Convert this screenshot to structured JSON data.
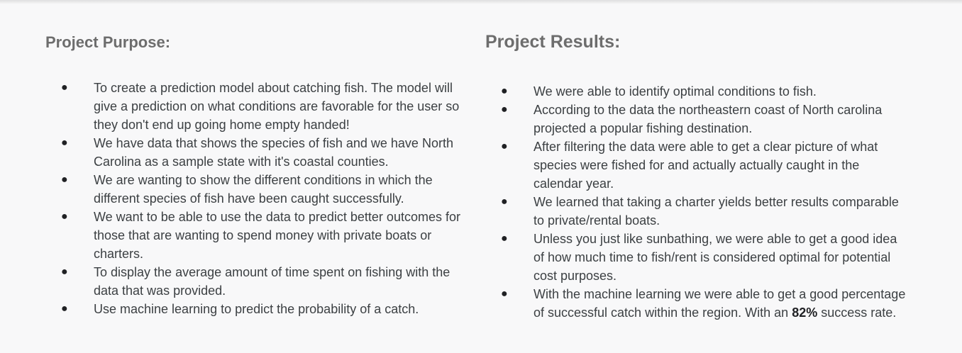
{
  "purpose": {
    "heading": "Project Purpose:",
    "items": [
      "To create a prediction model about catching fish. The model will give a prediction on what conditions are favorable for the user so they don't end up going home empty handed!",
      "We have data that shows the species of fish and we have North Carolina as a sample state with it's coastal counties.",
      "We are wanting to show the different conditions in which the different species of fish have been caught successfully.",
      "We want to be able to use the data to predict better outcomes for those that are wanting to spend money with private boats or charters.",
      "To display the average amount of time spent on fishing with the data that was provided.",
      "Use machine learning to predict the probability of a catch."
    ]
  },
  "results": {
    "heading": "Project Results:",
    "items": [
      "We were able to identify optimal conditions to fish.",
      "According to the data the northeastern coast of North carolina projected a popular fishing destination.",
      "After filtering the data were able to get a clear picture of what species were fished for and actually actually caught in the calendar year.",
      "We learned that taking a charter yields better results comparable to private/rental boats.",
      "Unless you just like sunbathing, we were able to get a good idea of how much time to fish/rent is considered optimal for potential cost purposes."
    ],
    "last_item_text": "With the machine learning we were able to get a good percentage of successful catch within the region. With an",
    "last_item_highlight": "82%",
    "last_item_suffix": "success rate."
  },
  "bullet_glyph": "●"
}
